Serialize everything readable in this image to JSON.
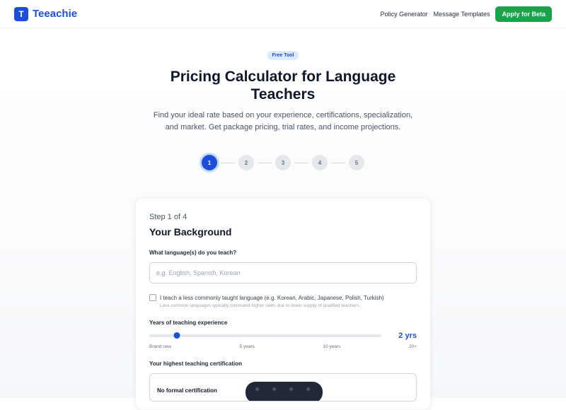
{
  "nav": {
    "brand_letter": "T",
    "brand_name": "Teeachie",
    "links": [
      "Policy Generator",
      "Message Templates"
    ],
    "cta": "Apply for Beta"
  },
  "hero": {
    "badge": "Free Tool",
    "title": "Pricing Calculator for Language Teachers",
    "subtitle": "Find your ideal rate based on your experience, certifications, specialization, and market. Get package pricing, trial rates, and income projections."
  },
  "stepper": {
    "steps": [
      "1",
      "2",
      "3",
      "4",
      "5"
    ],
    "active_index": 0
  },
  "card": {
    "step_of": "Step 1 of 4",
    "title": "Your Background",
    "language_label": "What language(s) do you teach?",
    "language_placeholder": "e.g. English, Spanish, Korean",
    "language_value": "",
    "less_common_label": "I teach a less commonly taught language (e.g. Korean, Arabic, Japanese, Polish, Turkish)",
    "less_common_checked": false,
    "less_common_help": "Less common languages typically command higher rates due to lower supply of qualified teachers.",
    "experience_label": "Years of teaching experience",
    "experience_value_text": "2 yrs",
    "experience_years": 2,
    "experience_max": 20,
    "experience_ticks": [
      "Brand new",
      "5 years",
      "10 years",
      "20+"
    ],
    "cert_label": "Your highest teaching certification",
    "cert_option": "No formal certification"
  },
  "colors": {
    "brand_blue": "#1d4ed8",
    "cta_green": "#16a34a",
    "badge_bg": "#dbeafe"
  }
}
